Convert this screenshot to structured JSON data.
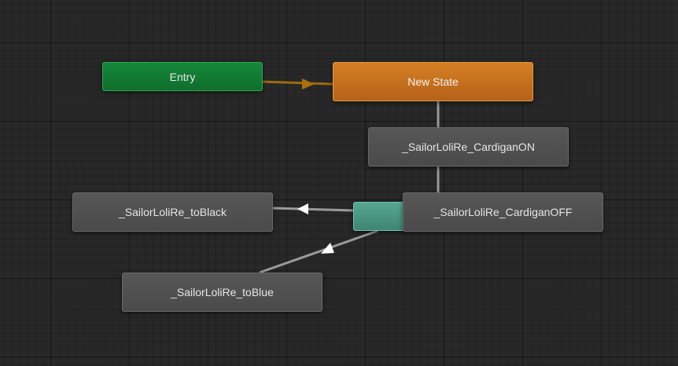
{
  "graph": {
    "entry": {
      "label": "Entry"
    },
    "default_state": {
      "label": "New State"
    },
    "states": {
      "cardigan_on": {
        "label": "_SailorLoliRe_CardiganON"
      },
      "cardigan_off": {
        "label": "_SailorLoliRe_CardiganOFF"
      },
      "to_black": {
        "label": "_SailorLoliRe_toBlack"
      },
      "to_blue": {
        "label": "_SailorLoliRe_toBlue"
      }
    },
    "colors": {
      "background": "#282828",
      "entry_node": "#0f7a32",
      "default_state_node": "#c86e1f",
      "state_node": "#505050",
      "state_machine_node": "#4a9a86",
      "default_transition": "#9c6a10",
      "transition": "#9a9a9a"
    }
  }
}
